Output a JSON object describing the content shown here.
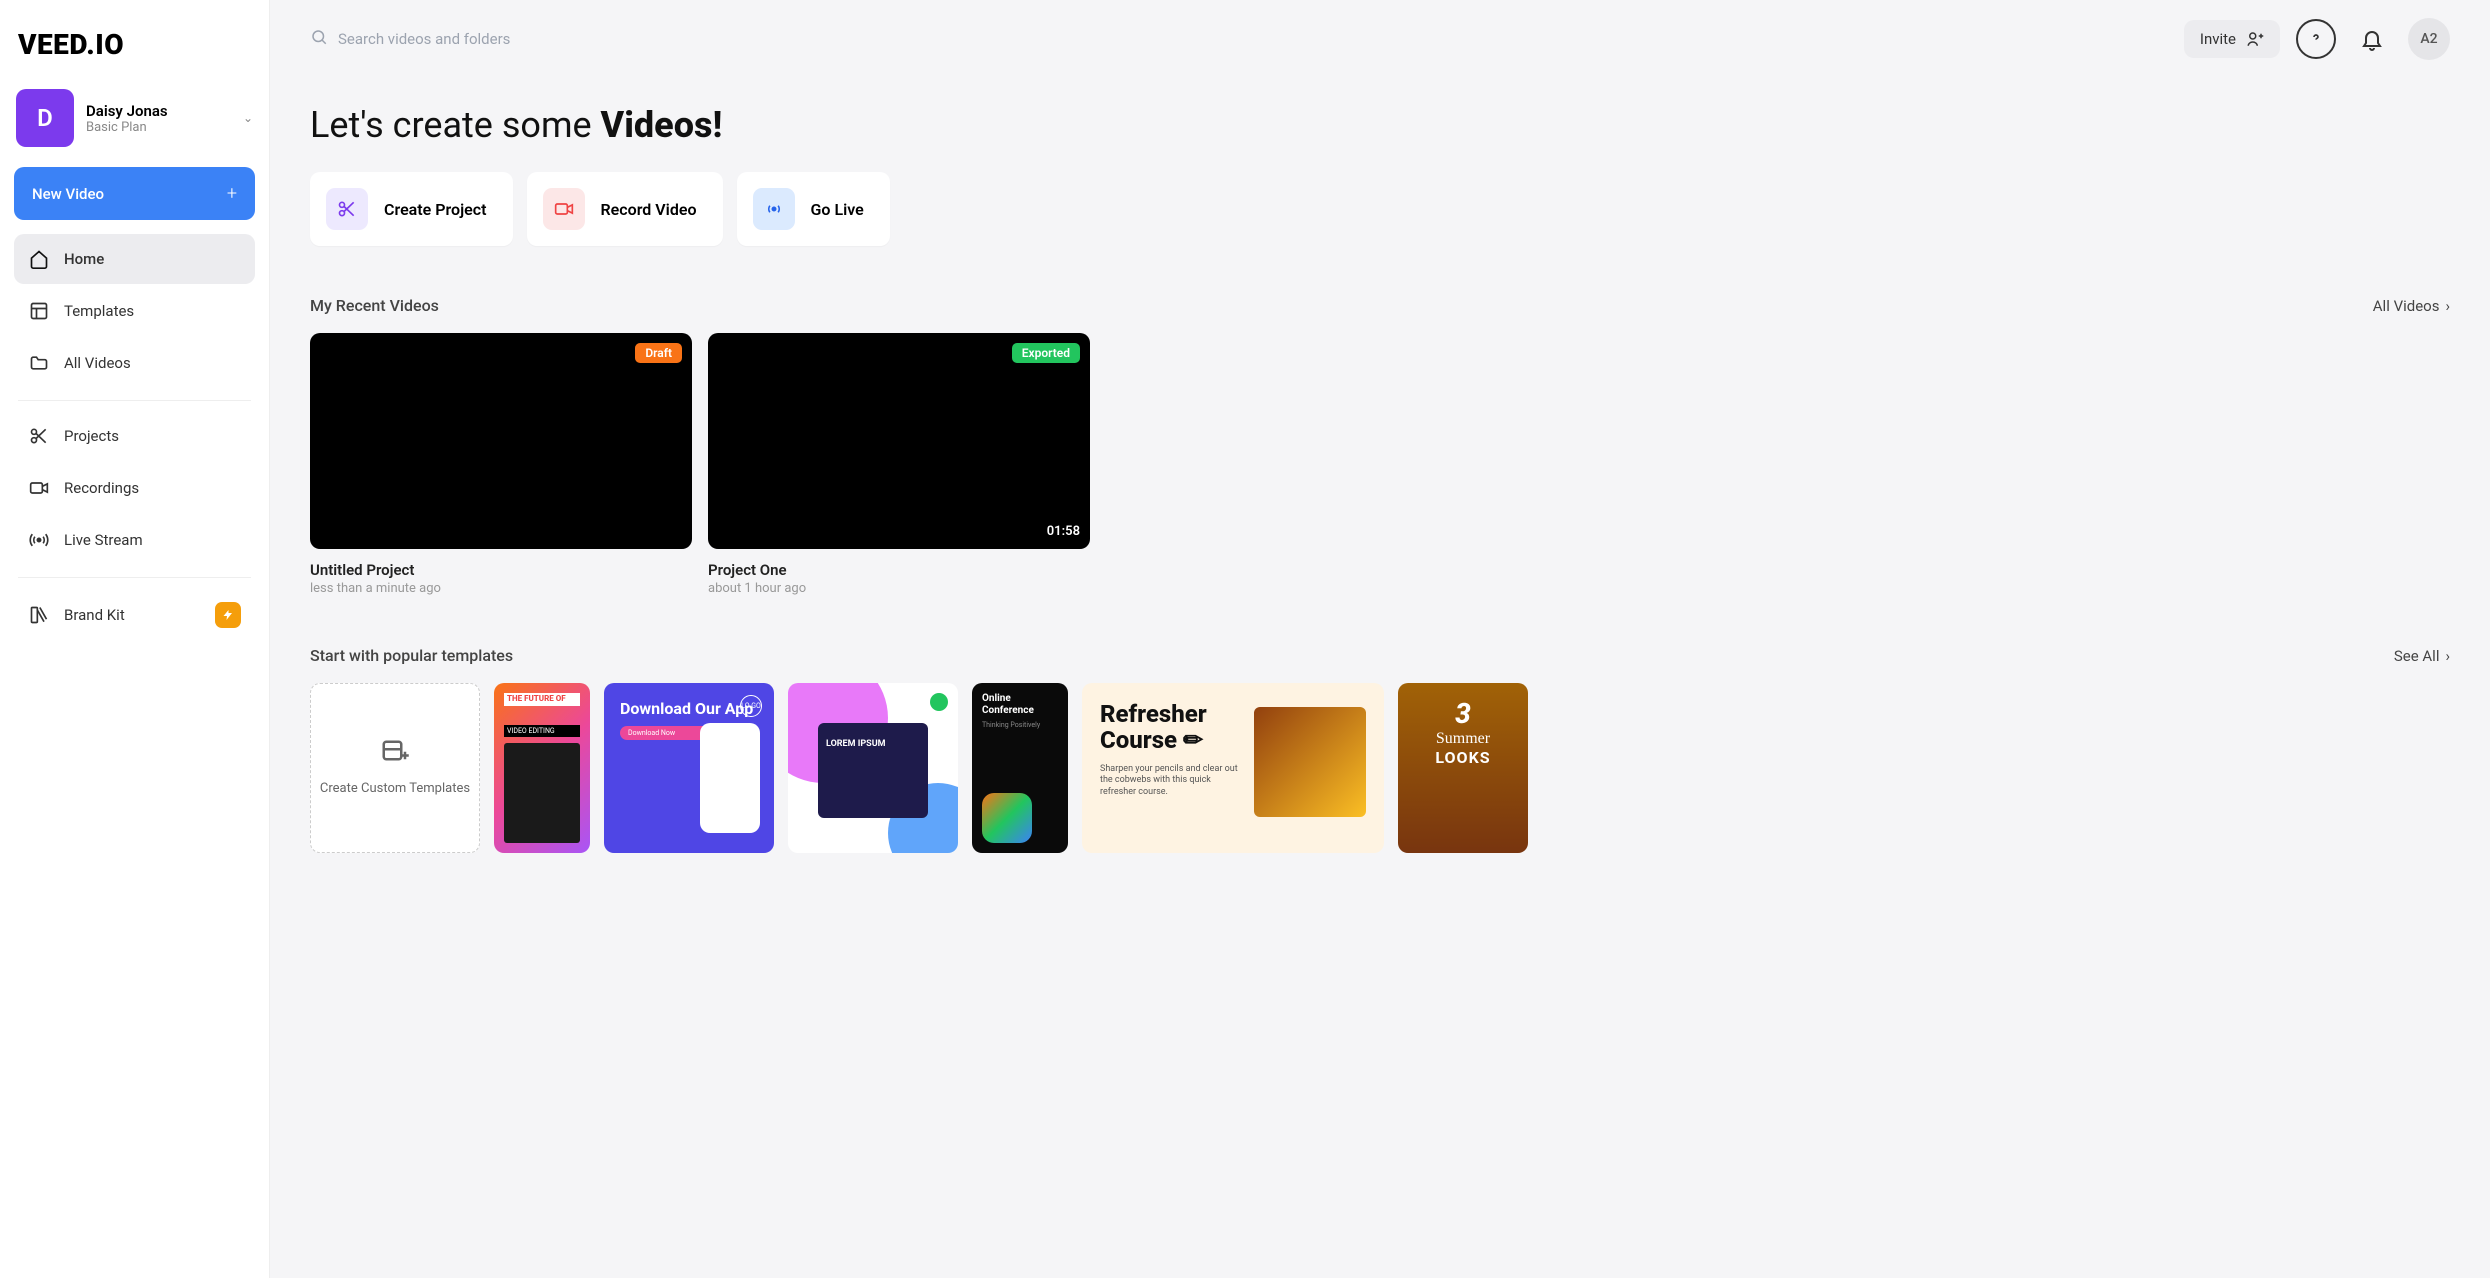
{
  "logo": "VEED.IO",
  "user": {
    "initial": "D",
    "name": "Daisy Jonas",
    "plan": "Basic Plan"
  },
  "sidebar": {
    "new_video": "New Video",
    "items": [
      {
        "label": "Home"
      },
      {
        "label": "Templates"
      },
      {
        "label": "All Videos"
      },
      {
        "label": "Projects"
      },
      {
        "label": "Recordings"
      },
      {
        "label": "Live Stream"
      },
      {
        "label": "Brand Kit"
      }
    ]
  },
  "topbar": {
    "search_placeholder": "Search videos and folders",
    "invite": "Invite",
    "avatar": "A2"
  },
  "hero": {
    "prefix": "Let's create some ",
    "bold": "Videos!"
  },
  "actions": {
    "create": "Create Project",
    "record": "Record Video",
    "live": "Go Live"
  },
  "recent": {
    "title": "My Recent Videos",
    "all": "All Videos",
    "videos": [
      {
        "title": "Untitled Project",
        "meta": "less than a minute ago",
        "status": "Draft",
        "duration": ""
      },
      {
        "title": "Project One",
        "meta": "about 1 hour ago",
        "status": "Exported",
        "duration": "01:58"
      }
    ]
  },
  "templates": {
    "title": "Start with popular templates",
    "see_all": "See All",
    "custom": "Create Custom Templates",
    "cards": {
      "t1_line1": "THE FUTURE OF",
      "t1_line2": "VIDEO EDITING",
      "t2_title": "Download Our App",
      "t2_btn": "Download Now",
      "t2_logo": "LO GO",
      "t3_text": "LOREM IPSUM",
      "t4_title": "Online Conference",
      "t4_sub": "Thinking Positively",
      "t5_title": "Refresher Course ✏",
      "t5_body": "Sharpen your pencils and clear out the cobwebs with this quick refresher course.",
      "t6_num": "3",
      "t6_w1": "Summer",
      "t6_w2": "LOOKS"
    }
  }
}
